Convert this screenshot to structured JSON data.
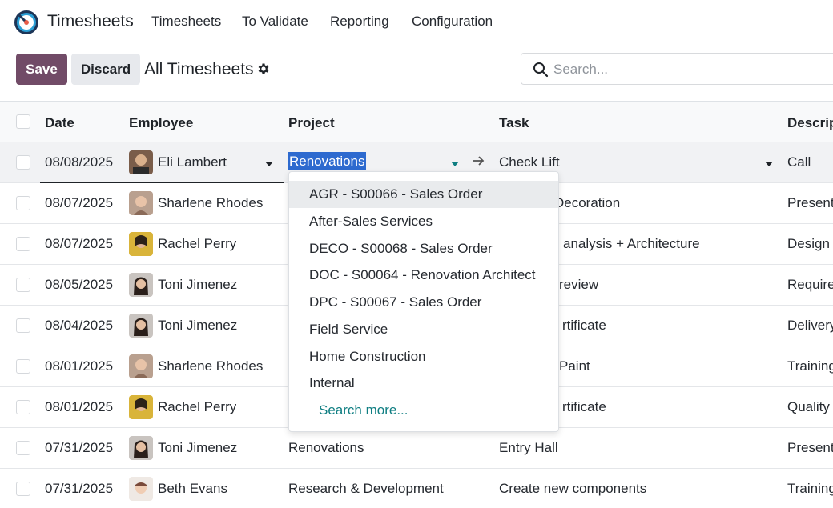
{
  "app": {
    "title": "Timesheets",
    "nav": [
      "Timesheets",
      "To Validate",
      "Reporting",
      "Configuration"
    ]
  },
  "control": {
    "save_label": "Save",
    "discard_label": "Discard",
    "view_title": "All Timesheets",
    "search_placeholder": "Search..."
  },
  "table": {
    "headers": {
      "date": "Date",
      "employee": "Employee",
      "project": "Project",
      "task": "Task",
      "description": "Descrip"
    },
    "editing_row": {
      "date": "08/08/2025",
      "employee": "Eli Lambert",
      "project": "Renovations",
      "task": "Check Lift",
      "description": "Call"
    },
    "rows": [
      {
        "date": "08/07/2025",
        "employee": "Sharlene Rhodes",
        "project": "",
        "task": "Decoration",
        "description": "Present"
      },
      {
        "date": "08/07/2025",
        "employee": "Rachel Perry",
        "project": "",
        "task": "analysis + Architecture",
        "description": "Design"
      },
      {
        "date": "08/05/2025",
        "employee": "Toni Jimenez",
        "project": "",
        "task": "review",
        "description": "Require"
      },
      {
        "date": "08/04/2025",
        "employee": "Toni Jimenez",
        "project": "",
        "task": "rtificate",
        "description": "Delivery"
      },
      {
        "date": "08/01/2025",
        "employee": "Sharlene Rhodes",
        "project": "",
        "task": "Paint",
        "description": "Training"
      },
      {
        "date": "08/01/2025",
        "employee": "Rachel Perry",
        "project": "",
        "task": "rtificate",
        "description": "Quality"
      },
      {
        "date": "07/31/2025",
        "employee": "Toni Jimenez",
        "project": "Renovations",
        "task": "Entry Hall",
        "description": "Present"
      },
      {
        "date": "07/31/2025",
        "employee": "Beth Evans",
        "project": "Research & Development",
        "task": "Create new components",
        "description": "Training"
      }
    ]
  },
  "dropdown": {
    "options": [
      "AGR - S00066 - Sales Order",
      "After-Sales Services",
      "DECO - S00068 - Sales Order",
      "DOC - S00064 - Renovation Architect",
      "DPC - S00067 - Sales Order",
      "Field Service",
      "Home Construction",
      "Internal"
    ],
    "search_more": "Search more..."
  },
  "colors": {
    "brand": "#714b67",
    "link": "#0f7e82",
    "selection": "#2d6acf"
  },
  "icons": {
    "search": "search-icon",
    "gear": "gear-icon",
    "arrow": "arrow-right-icon",
    "caret": "caret-down-icon"
  }
}
